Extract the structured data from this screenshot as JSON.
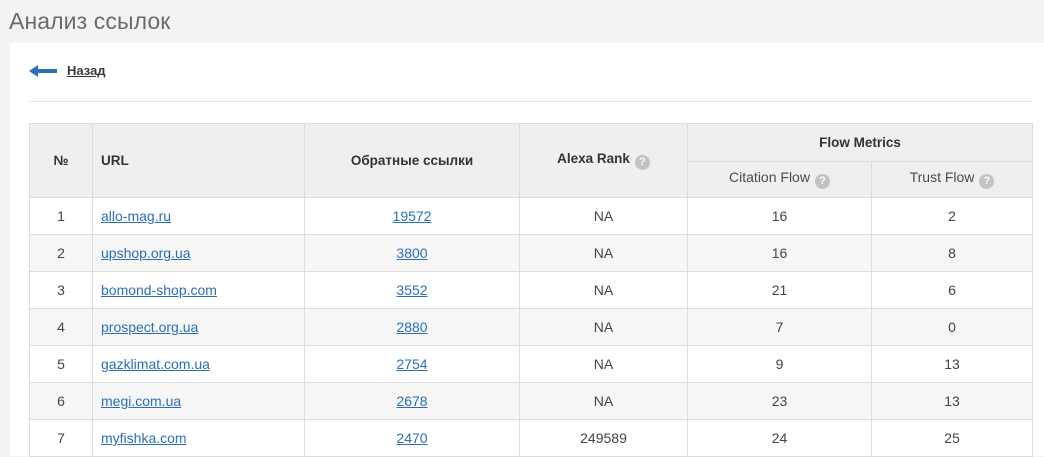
{
  "page": {
    "title": "Анализ ссылок"
  },
  "nav": {
    "back_label": "Назад"
  },
  "table": {
    "headers": {
      "num": "№",
      "url": "URL",
      "backlinks": "Обратные ссылки",
      "alexa": "Alexa Rank",
      "flow_metrics": "Flow Metrics",
      "citation_flow": "Citation Flow",
      "trust_flow": "Trust Flow"
    },
    "help_icon": "?",
    "rows": [
      {
        "num": "1",
        "url": "allo-mag.ru",
        "backlinks": "19572",
        "alexa": "NA",
        "citation": "16",
        "trust": "2"
      },
      {
        "num": "2",
        "url": "upshop.org.ua",
        "backlinks": "3800",
        "alexa": "NA",
        "citation": "16",
        "trust": "8"
      },
      {
        "num": "3",
        "url": "bomond-shop.com",
        "backlinks": "3552",
        "alexa": "NA",
        "citation": "21",
        "trust": "6"
      },
      {
        "num": "4",
        "url": "prospect.org.ua",
        "backlinks": "2880",
        "alexa": "NA",
        "citation": "7",
        "trust": "0"
      },
      {
        "num": "5",
        "url": "gazklimat.com.ua",
        "backlinks": "2754",
        "alexa": "NA",
        "citation": "9",
        "trust": "13"
      },
      {
        "num": "6",
        "url": "megi.com.ua",
        "backlinks": "2678",
        "alexa": "NA",
        "citation": "23",
        "trust": "13"
      },
      {
        "num": "7",
        "url": "myfishka.com",
        "backlinks": "2470",
        "alexa": "249589",
        "citation": "24",
        "trust": "25"
      }
    ]
  },
  "colors": {
    "link": "#2a6fb7",
    "back_arrow": "#2a6fb7",
    "header_bg": "#efefef"
  }
}
